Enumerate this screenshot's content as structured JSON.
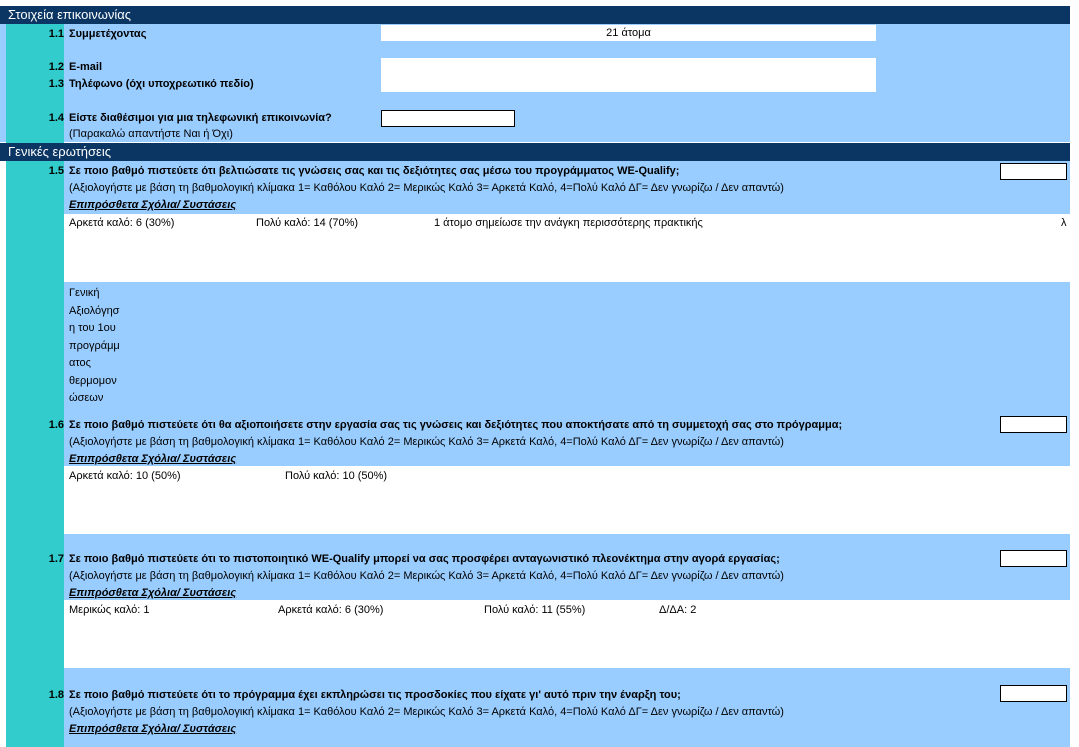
{
  "contact": {
    "header": "Στοιχεία επικοινωνίας",
    "q11": {
      "num": "1.1",
      "label": "Συμμετέχοντας",
      "value": "21 άτομα"
    },
    "q12": {
      "num": "1.2",
      "label": "E-mail"
    },
    "q13": {
      "num": "1.3",
      "label": "Τηλέφωνο (όχι υποχρεωτικό πεδίο)"
    },
    "q14": {
      "num": "1.4",
      "label": "Είστε διαθέσιμοι για μια τηλεφωνική επικοινωνία?",
      "hint": "(Παρακαλώ απαντήστε Ναι ή Όχι)"
    }
  },
  "general": {
    "header": "Γενικές ερωτήσεις",
    "q15": {
      "num": "1.5",
      "label": "Σε ποιο βαθμό πιστεύετε ότι βελτιώσατε τις γνώσεις σας και τις δεξιότητες σας μέσω του προγράμματος WE-Qualify;",
      "hint": "(Αξιολογήστε με βάση τη βαθμολογική κλίμακα 1= Καθόλου Καλό 2= Μερικώς Καλό 3= Αρκετά Καλό, 4=Πολύ Καλό ΔΓ= Δεν γνωρίζω / Δεν απαντώ)",
      "extra": "Επιπρόσθετα Σχόλια/ Συστάσεις",
      "answers": [
        "Αρκετά καλό: 6 (30%)",
        "Πολύ καλό: 14 (70%)",
        "1 άτομο σημείωσε την ανάγκη περισσότερης πρακτικής",
        "λ"
      ]
    },
    "side_note": [
      "Γενική",
      "Αξιολόγησ",
      "η του 1ου",
      "προγράμμ",
      "ατος",
      "θερμομον",
      "ώσεων"
    ],
    "q16": {
      "num": "1.6",
      "label": "Σε ποιο βαθμό πιστεύετε ότι θα αξιοποιήσετε στην εργασία σας τις γνώσεις και δεξιότητες που αποκτήσατε από τη συμμετοχή σας στο πρόγραμμα;",
      "hint": "(Αξιολογήστε με βάση τη βαθμολογική κλίμακα 1= Καθόλου Καλό 2= Μερικώς Καλό 3= Αρκετά Καλό, 4=Πολύ Καλό ΔΓ= Δεν γνωρίζω / Δεν απαντώ)",
      "extra": "Επιπρόσθετα Σχόλια/ Συστάσεις",
      "answers": [
        "Αρκετά καλό: 10 (50%)",
        "Πολύ καλό: 10 (50%)"
      ]
    },
    "q17": {
      "num": "1.7",
      "label": "Σε ποιο βαθμό πιστεύετε ότι το πιστοποιητικό WE-Qualify μπορεί να σας προσφέρει ανταγωνιστικό πλεονέκτημα στην αγορά εργασίας;",
      "hint": "(Αξιολογήστε με βάση τη βαθμολογική κλίμακα 1= Καθόλου Καλό 2= Μερικώς Καλό 3= Αρκετά Καλό, 4=Πολύ Καλό ΔΓ= Δεν γνωρίζω / Δεν απαντώ)",
      "extra": "Επιπρόσθετα Σχόλια/ Συστάσεις",
      "answers": [
        "Μερικώς καλό: 1",
        "Αρκετά καλό: 6 (30%)",
        "Πολύ καλό: 11 (55%)",
        "Δ/ΔΑ: 2"
      ]
    },
    "q18": {
      "num": "1.8",
      "label": "Σε ποιο βαθμό πιστεύετε ότι το πρόγραμμα έχει εκπληρώσει τις προσδοκίες που είχατε γι' αυτό πριν την έναρξη του;",
      "hint": "(Αξιολογήστε με βάση τη βαθμολογική κλίμακα 1= Καθόλου Καλό 2= Μερικώς Καλό 3= Αρκετά Καλό, 4=Πολύ Καλό ΔΓ= Δεν γνωρίζω / Δεν απαντώ)",
      "extra": "Επιπρόσθετα Σχόλια/ Συστάσεις"
    }
  }
}
